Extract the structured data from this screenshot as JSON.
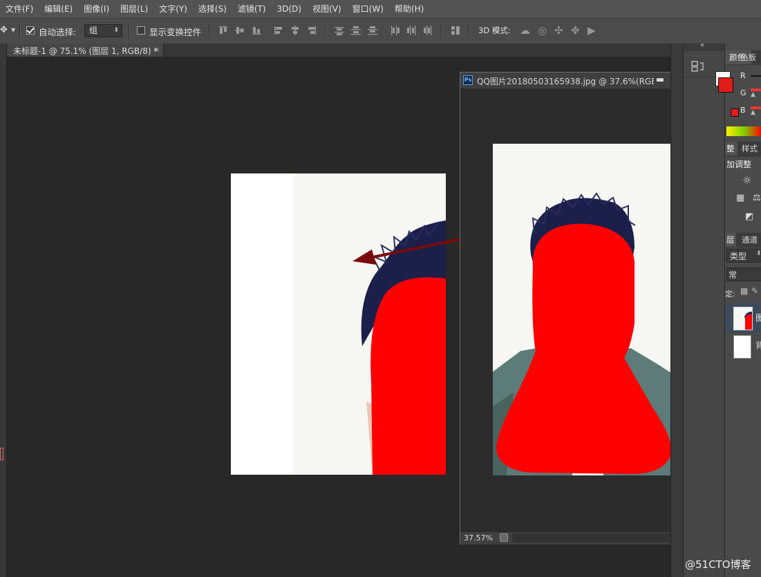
{
  "menu": [
    "文件(F)",
    "编辑(E)",
    "图像(I)",
    "图层(L)",
    "文字(Y)",
    "选择(S)",
    "滤镜(T)",
    "3D(D)",
    "视图(V)",
    "窗口(W)",
    "帮助(H)"
  ],
  "options": {
    "auto_select_label": "自动选择:",
    "auto_select_checked": true,
    "auto_select_target": "组",
    "show_transform_label": "显示变换控件",
    "show_transform_checked": false,
    "mode_3d_label": "3D 模式:"
  },
  "document_tab": {
    "title": "未标题-1 @ 75.1% (图层 1, RGB/8) *",
    "close": "×"
  },
  "float_window": {
    "app_icon": "Ps",
    "title": "QQ图片20180503165938.jpg @ 37.6%(RGB/...",
    "minimize": "▬",
    "restore": "☐",
    "close": "✕",
    "zoom": "37.57%"
  },
  "panels": {
    "color_tab": "颜色",
    "swatches_tab": "色板",
    "channel_labels": [
      "R",
      "G",
      "B"
    ],
    "adjustments_tab_partial": "整",
    "styles_tab": "样式",
    "adjustments_heading": "加调整",
    "layers_tab_partial": "层",
    "channels_tab": "通道",
    "filter_kind": "类型",
    "blend_mode": "常",
    "lock_label": "定:",
    "layer1_name_partial": "图",
    "layer2_name_partial": "背"
  },
  "colors": {
    "foreground": "#e21b1b",
    "accent_red": "#ff0000",
    "arrow": "#7a0b0b",
    "hair": "#1c1f4a"
  },
  "watermark": "@51CTO博客"
}
